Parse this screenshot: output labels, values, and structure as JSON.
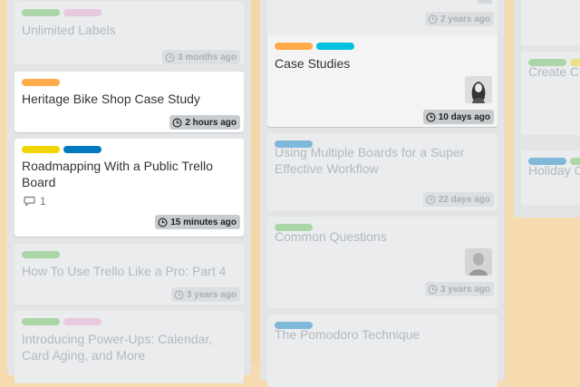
{
  "colors": {
    "green": "#61bd4f",
    "pink": "#e8a0c8",
    "orange": "#ffab4a",
    "yellow": "#f2d600",
    "blue": "#0079bf",
    "sky": "#00c2e0",
    "lightblue": "#7bb3d9"
  },
  "list_left": {
    "cards": [
      {
        "title": "Unlimited Labels",
        "due": "3 months ago"
      },
      {
        "title": "Heritage Bike Shop Case Study",
        "due": "2 hours ago"
      },
      {
        "title": "Roadmapping With a Public Trello Board",
        "due": "15 minutes ago",
        "comments": "1"
      },
      {
        "title": "How To Use Trello Like a Pro: Part 4",
        "due": "3 years ago"
      },
      {
        "title": "Introducing Power-Ups: Calendar, Card Aging, and More"
      }
    ]
  },
  "list_middle": {
    "cards": [
      {
        "due": "2 years ago"
      },
      {
        "title": "Case Studies",
        "due": "10 days ago",
        "avatar": "member-avatar-woman"
      },
      {
        "title": "Using Multiple Boards for a Super Effective Workflow",
        "due": "22 days ago"
      },
      {
        "title": "Common Questions",
        "due": "3 years ago",
        "avatar": "member-avatar-man"
      },
      {
        "title": "The Pomodoro Technique"
      }
    ]
  },
  "list_right": {
    "cards": [
      {
        "title": "Create C"
      },
      {
        "title": "Holiday C"
      }
    ]
  }
}
